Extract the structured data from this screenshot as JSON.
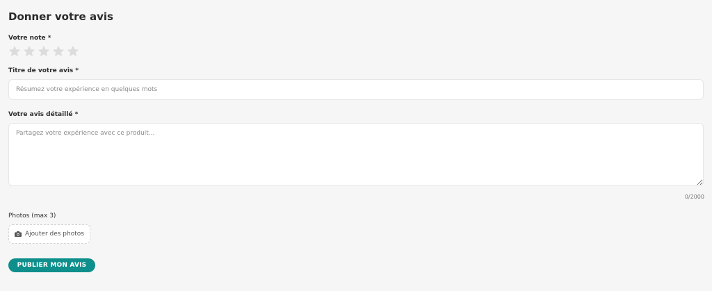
{
  "form": {
    "title": "Donner votre avis",
    "rating_label": "Votre note *",
    "rating": {
      "value": 0,
      "max": 5,
      "empty_color": "#dcdcdc",
      "filled_color": "#f5b301"
    },
    "review_title_label": "Titre de votre avis *",
    "review_title_placeholder": "Résumez votre expérience en quelques mots",
    "review_title_value": "",
    "review_body_label": "Votre avis détaillé *",
    "review_body_placeholder": "Partagez votre expérience avec ce produit...",
    "review_body_value": "",
    "char_counter": "0/2000",
    "photos_label": "Photos (max 3)",
    "add_photos_label": "Ajouter des photos",
    "add_photos_icon": "camera-icon",
    "submit_label": "PUBLIER MON AVIS",
    "accent_color": "#0f8f8c"
  }
}
